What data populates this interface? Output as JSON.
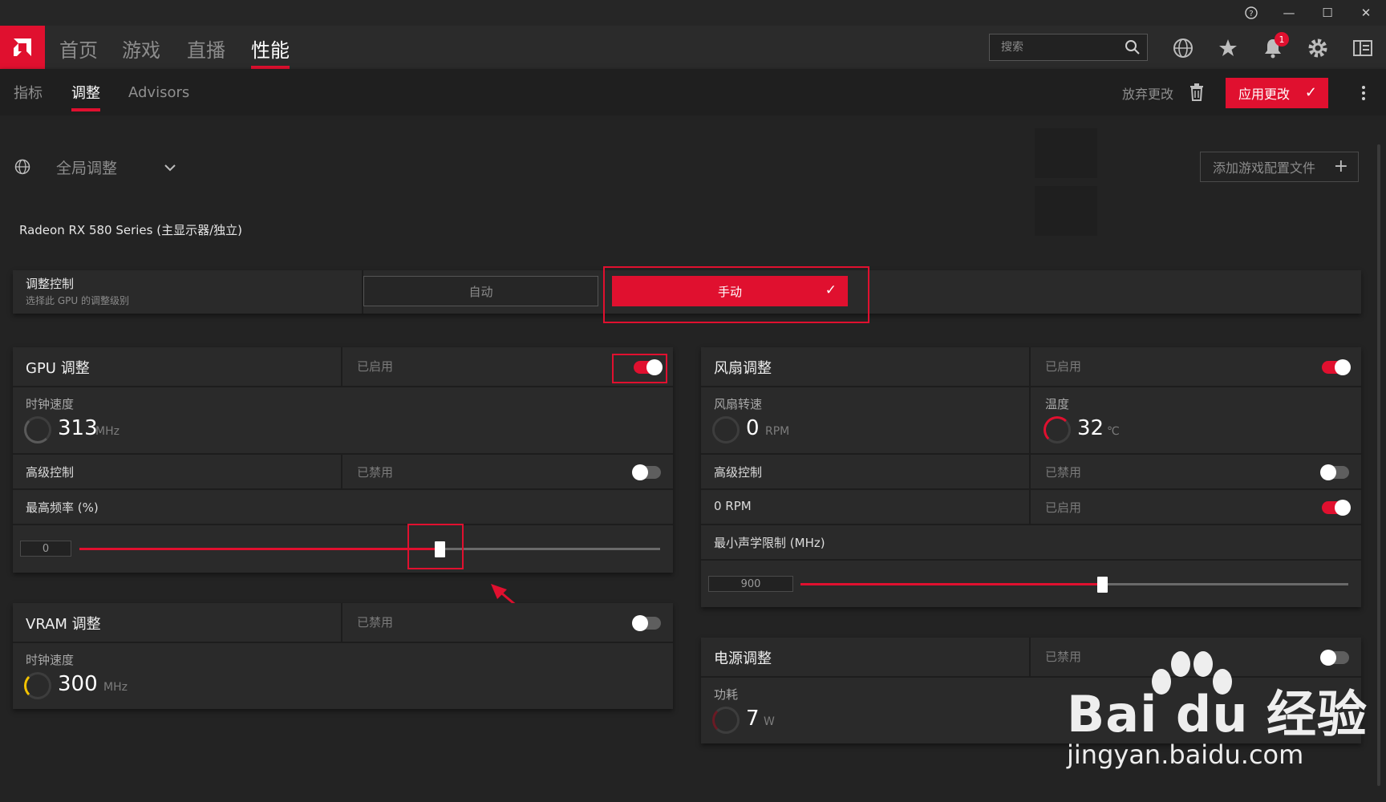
{
  "window": {
    "help_icon": "help-circle-icon",
    "minimize": "—",
    "maximize": "☐",
    "close": "✕"
  },
  "nav": {
    "tabs": [
      {
        "label": "首页"
      },
      {
        "label": "游戏"
      },
      {
        "label": "直播"
      },
      {
        "label": "性能"
      }
    ],
    "active_tab": "性能",
    "search_placeholder": "搜索",
    "notification_count": "1"
  },
  "subnav": {
    "tabs": [
      {
        "label": "指标"
      },
      {
        "label": "调整"
      },
      {
        "label": "Advisors"
      }
    ],
    "active_tab": "调整",
    "discard_label": "放弃更改",
    "apply_label": "应用更改"
  },
  "profile": {
    "selected": "全局调整",
    "add_profile_label": "添加游戏配置文件"
  },
  "gpu_name": "Radeon RX 580 Series (主显示器/独立)",
  "tuning_control": {
    "title": "调整控制",
    "subtitle": "选择此 GPU 的调整级别",
    "auto_label": "自动",
    "manual_label": "手动",
    "selected": "手动"
  },
  "gpu_tuning": {
    "title": "GPU 调整",
    "status": "已启用",
    "enabled": true,
    "clock_label": "时钟速度",
    "clock_value": "313",
    "clock_unit": "MHz",
    "advanced_label": "高级控制",
    "advanced_status": "已禁用",
    "advanced_enabled": false,
    "max_freq_label": "最高频率 (%)",
    "max_freq_value": "0",
    "max_freq_slider_fraction": 0.62
  },
  "vram_tuning": {
    "title": "VRAM 调整",
    "status": "已禁用",
    "enabled": false,
    "clock_label": "时钟速度",
    "clock_value": "300",
    "clock_unit": "MHz"
  },
  "fan_tuning": {
    "title": "风扇调整",
    "status": "已启用",
    "enabled": true,
    "speed_label": "风扇转速",
    "speed_value": "0",
    "speed_unit": "RPM",
    "temp_label": "温度",
    "temp_value": "32",
    "temp_unit": "℃",
    "advanced_label": "高级控制",
    "advanced_status": "已禁用",
    "advanced_enabled": false,
    "zero_rpm_label": "0 RPM",
    "zero_rpm_status": "已启用",
    "zero_rpm_enabled": true,
    "min_acoustic_label": "最小声学限制 (MHz)",
    "min_acoustic_value": "900",
    "min_acoustic_slider_fraction": 0.55
  },
  "power_tuning": {
    "title": "电源调整",
    "status": "已禁用",
    "enabled": false,
    "power_label": "功耗",
    "power_value": "7",
    "power_unit": "W"
  },
  "watermark": {
    "brand": "Bai du 经验",
    "url": "jingyan.baidu.com"
  },
  "colors": {
    "accent": "#e0102f",
    "background": "#232323",
    "panel": "#2a2a2a",
    "gauge_gpu": "#5a5a5a",
    "gauge_vram": "#f2c200",
    "gauge_temp": "#e0102f"
  }
}
